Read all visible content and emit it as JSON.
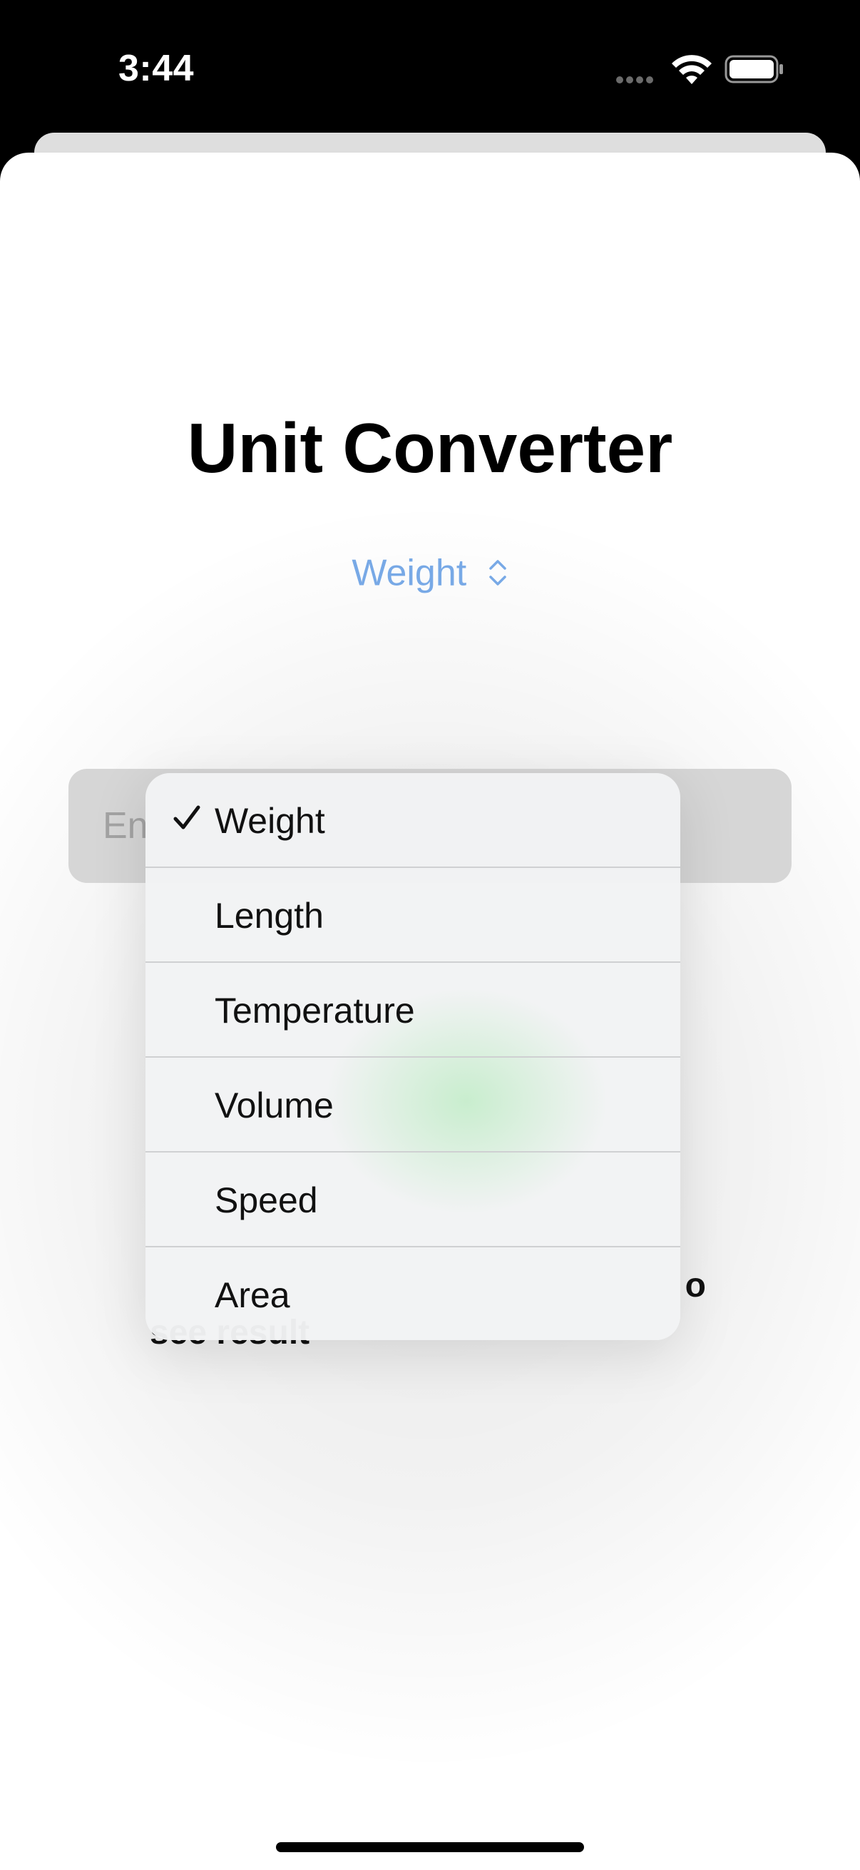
{
  "status_bar": {
    "time": "3:44"
  },
  "screen": {
    "title": "Unit Converter",
    "picker": {
      "selected": "Weight"
    },
    "input": {
      "placeholder_visible": "En"
    },
    "result": {
      "line1_visible": "o",
      "line2_visible": "see result"
    }
  },
  "menu": {
    "items": [
      {
        "label": "Weight",
        "checked": true
      },
      {
        "label": "Length",
        "checked": false
      },
      {
        "label": "Temperature",
        "checked": false
      },
      {
        "label": "Volume",
        "checked": false
      },
      {
        "label": "Speed",
        "checked": false
      },
      {
        "label": "Area",
        "checked": false
      }
    ]
  },
  "colors": {
    "accent": "#78a9e6",
    "field_bg": "#d6d6d6"
  },
  "icons": [
    "wifi-icon",
    "battery-icon",
    "chevron-up-down-icon",
    "checkmark-icon"
  ]
}
